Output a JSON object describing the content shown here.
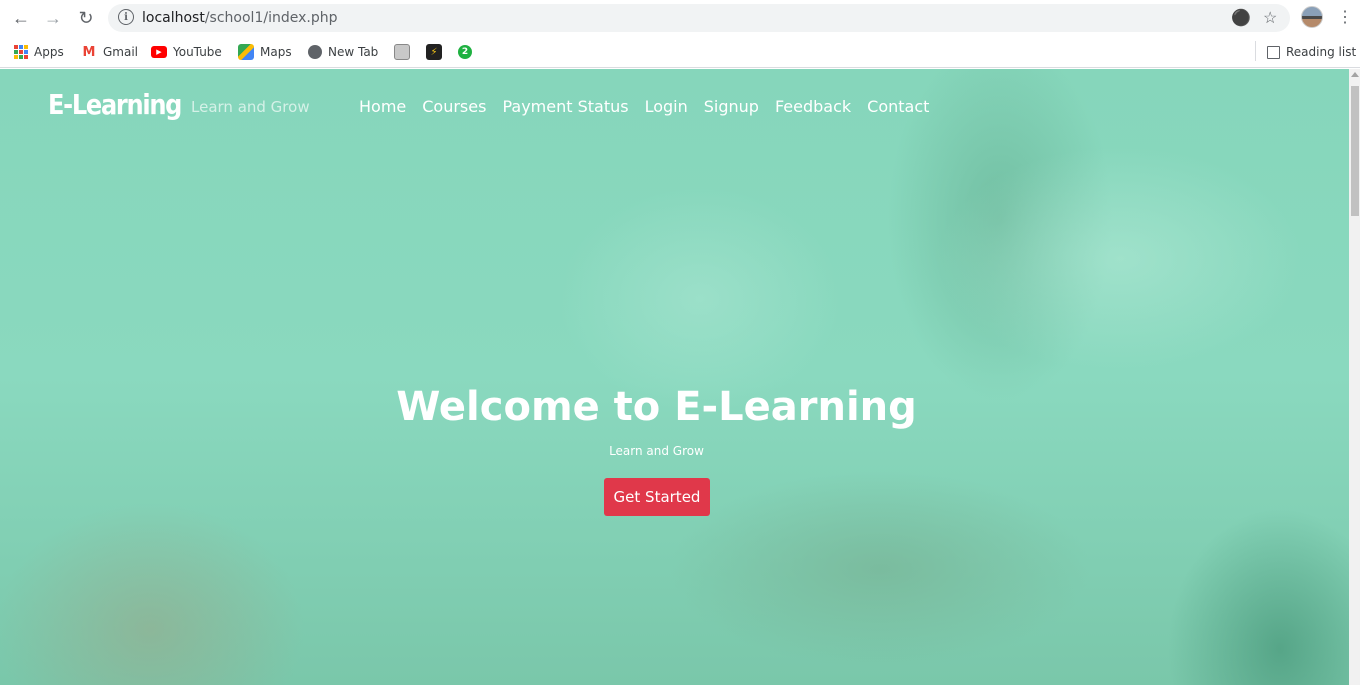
{
  "browser": {
    "url_host": "localhost",
    "url_path": "/school1/index.php",
    "bookmarks": [
      {
        "label": "Apps",
        "icon": "apps-grid-icon"
      },
      {
        "label": "Gmail",
        "icon": "gmail-icon"
      },
      {
        "label": "YouTube",
        "icon": "youtube-icon"
      },
      {
        "label": "Maps",
        "icon": "maps-icon"
      },
      {
        "label": "New Tab",
        "icon": "globe-icon"
      },
      {
        "label": "",
        "icon": "bookmark-favicon-1"
      },
      {
        "label": "",
        "icon": "bookmark-favicon-2"
      },
      {
        "label": "",
        "icon": "bookmark-favicon-3"
      }
    ],
    "reading_list_label": "Reading list",
    "extension_badge": "2"
  },
  "site": {
    "logo": "E-Learning",
    "tagline": "Learn and Grow",
    "nav": [
      "Home",
      "Courses",
      "Payment Status",
      "Login",
      "Signup",
      "Feedback",
      "Contact"
    ]
  },
  "hero": {
    "title": "Welcome to E-Learning",
    "subtitle": "Learn and Grow",
    "cta_label": "Get Started"
  },
  "colors": {
    "overlay": "#86d6bb",
    "cta": "#e0384a"
  }
}
